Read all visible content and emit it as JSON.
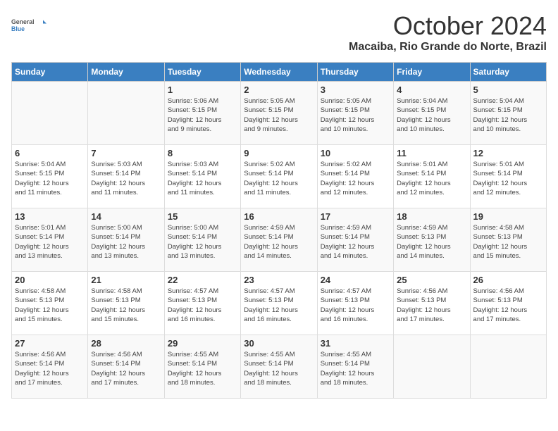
{
  "logo": {
    "general": "General",
    "blue": "Blue"
  },
  "title": "October 2024",
  "location": "Macaiba, Rio Grande do Norte, Brazil",
  "days_of_week": [
    "Sunday",
    "Monday",
    "Tuesday",
    "Wednesday",
    "Thursday",
    "Friday",
    "Saturday"
  ],
  "weeks": [
    [
      {
        "day": "",
        "info": ""
      },
      {
        "day": "",
        "info": ""
      },
      {
        "day": "1",
        "info": "Sunrise: 5:06 AM\nSunset: 5:15 PM\nDaylight: 12 hours\nand 9 minutes."
      },
      {
        "day": "2",
        "info": "Sunrise: 5:05 AM\nSunset: 5:15 PM\nDaylight: 12 hours\nand 9 minutes."
      },
      {
        "day": "3",
        "info": "Sunrise: 5:05 AM\nSunset: 5:15 PM\nDaylight: 12 hours\nand 10 minutes."
      },
      {
        "day": "4",
        "info": "Sunrise: 5:04 AM\nSunset: 5:15 PM\nDaylight: 12 hours\nand 10 minutes."
      },
      {
        "day": "5",
        "info": "Sunrise: 5:04 AM\nSunset: 5:15 PM\nDaylight: 12 hours\nand 10 minutes."
      }
    ],
    [
      {
        "day": "6",
        "info": "Sunrise: 5:04 AM\nSunset: 5:15 PM\nDaylight: 12 hours\nand 11 minutes."
      },
      {
        "day": "7",
        "info": "Sunrise: 5:03 AM\nSunset: 5:14 PM\nDaylight: 12 hours\nand 11 minutes."
      },
      {
        "day": "8",
        "info": "Sunrise: 5:03 AM\nSunset: 5:14 PM\nDaylight: 12 hours\nand 11 minutes."
      },
      {
        "day": "9",
        "info": "Sunrise: 5:02 AM\nSunset: 5:14 PM\nDaylight: 12 hours\nand 11 minutes."
      },
      {
        "day": "10",
        "info": "Sunrise: 5:02 AM\nSunset: 5:14 PM\nDaylight: 12 hours\nand 12 minutes."
      },
      {
        "day": "11",
        "info": "Sunrise: 5:01 AM\nSunset: 5:14 PM\nDaylight: 12 hours\nand 12 minutes."
      },
      {
        "day": "12",
        "info": "Sunrise: 5:01 AM\nSunset: 5:14 PM\nDaylight: 12 hours\nand 12 minutes."
      }
    ],
    [
      {
        "day": "13",
        "info": "Sunrise: 5:01 AM\nSunset: 5:14 PM\nDaylight: 12 hours\nand 13 minutes."
      },
      {
        "day": "14",
        "info": "Sunrise: 5:00 AM\nSunset: 5:14 PM\nDaylight: 12 hours\nand 13 minutes."
      },
      {
        "day": "15",
        "info": "Sunrise: 5:00 AM\nSunset: 5:14 PM\nDaylight: 12 hours\nand 13 minutes."
      },
      {
        "day": "16",
        "info": "Sunrise: 4:59 AM\nSunset: 5:14 PM\nDaylight: 12 hours\nand 14 minutes."
      },
      {
        "day": "17",
        "info": "Sunrise: 4:59 AM\nSunset: 5:14 PM\nDaylight: 12 hours\nand 14 minutes."
      },
      {
        "day": "18",
        "info": "Sunrise: 4:59 AM\nSunset: 5:13 PM\nDaylight: 12 hours\nand 14 minutes."
      },
      {
        "day": "19",
        "info": "Sunrise: 4:58 AM\nSunset: 5:13 PM\nDaylight: 12 hours\nand 15 minutes."
      }
    ],
    [
      {
        "day": "20",
        "info": "Sunrise: 4:58 AM\nSunset: 5:13 PM\nDaylight: 12 hours\nand 15 minutes."
      },
      {
        "day": "21",
        "info": "Sunrise: 4:58 AM\nSunset: 5:13 PM\nDaylight: 12 hours\nand 15 minutes."
      },
      {
        "day": "22",
        "info": "Sunrise: 4:57 AM\nSunset: 5:13 PM\nDaylight: 12 hours\nand 16 minutes."
      },
      {
        "day": "23",
        "info": "Sunrise: 4:57 AM\nSunset: 5:13 PM\nDaylight: 12 hours\nand 16 minutes."
      },
      {
        "day": "24",
        "info": "Sunrise: 4:57 AM\nSunset: 5:13 PM\nDaylight: 12 hours\nand 16 minutes."
      },
      {
        "day": "25",
        "info": "Sunrise: 4:56 AM\nSunset: 5:13 PM\nDaylight: 12 hours\nand 17 minutes."
      },
      {
        "day": "26",
        "info": "Sunrise: 4:56 AM\nSunset: 5:13 PM\nDaylight: 12 hours\nand 17 minutes."
      }
    ],
    [
      {
        "day": "27",
        "info": "Sunrise: 4:56 AM\nSunset: 5:14 PM\nDaylight: 12 hours\nand 17 minutes."
      },
      {
        "day": "28",
        "info": "Sunrise: 4:56 AM\nSunset: 5:14 PM\nDaylight: 12 hours\nand 17 minutes."
      },
      {
        "day": "29",
        "info": "Sunrise: 4:55 AM\nSunset: 5:14 PM\nDaylight: 12 hours\nand 18 minutes."
      },
      {
        "day": "30",
        "info": "Sunrise: 4:55 AM\nSunset: 5:14 PM\nDaylight: 12 hours\nand 18 minutes."
      },
      {
        "day": "31",
        "info": "Sunrise: 4:55 AM\nSunset: 5:14 PM\nDaylight: 12 hours\nand 18 minutes."
      },
      {
        "day": "",
        "info": ""
      },
      {
        "day": "",
        "info": ""
      }
    ]
  ]
}
